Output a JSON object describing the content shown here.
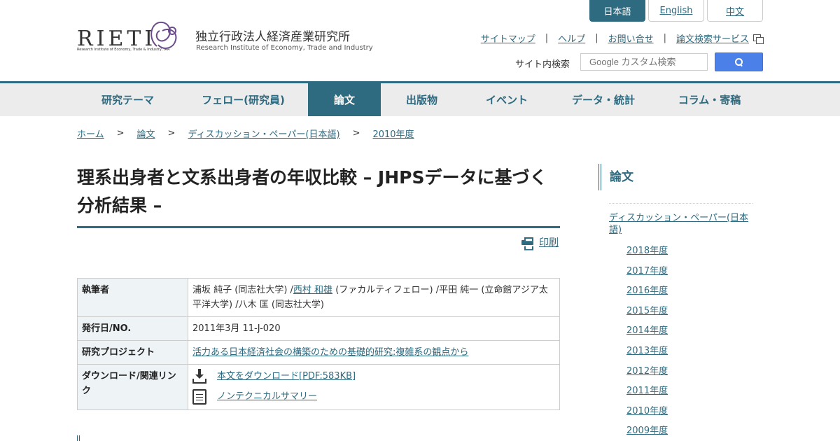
{
  "header": {
    "logo_text": "RIETI",
    "logo_subtext": "Research Institute of Economy, Trade & Industry, IAA",
    "org_name_ja": "独立行政法人経済産業研究所",
    "org_name_en": "Research Institute of Economy, Trade and Industry",
    "languages": [
      {
        "label": "日本語",
        "active": true
      },
      {
        "label": "English",
        "active": false
      },
      {
        "label": "中文",
        "active": false
      }
    ],
    "util_links": [
      "サイトマップ",
      "ヘルプ",
      "お問い合せ",
      "論文検索サービス"
    ],
    "util_separator": "|",
    "search_label": "サイト内検索",
    "search_placeholder": "Google カスタム検索",
    "search_button_icon": "search-icon"
  },
  "nav": {
    "items": [
      {
        "label": "研究テーマ",
        "active": false
      },
      {
        "label": "フェロー(研究員)",
        "active": false
      },
      {
        "label": "論文",
        "active": true
      },
      {
        "label": "出版物",
        "active": false
      },
      {
        "label": "イベント",
        "active": false
      },
      {
        "label": "データ・統計",
        "active": false
      },
      {
        "label": "コラム・寄稿",
        "active": false
      }
    ],
    "accent_color": "#2e6a80"
  },
  "breadcrumb": {
    "items": [
      "ホーム",
      "論文",
      "ディスカッション・ペーパー(日本語)",
      "2010年度"
    ],
    "separator": ">"
  },
  "article": {
    "title": "理系出身者と文系出身者の年収比較 – JHPSデータに基づく分析結果 –",
    "print_label": "印刷",
    "info": {
      "author_label": "執筆者",
      "author_1": "浦坂 純子 (同志社大学) /",
      "author_link": "西村 和雄",
      "author_2": " (ファカルティフェロー) /平田 純一 (立命館アジア太平洋大学) /八木 匡 (同志社大学)",
      "date_label": "発行日/NO.",
      "date_value": "2011年3月 11-J-020",
      "project_label": "研究プロジェクト",
      "project_value": "活力ある日本経済社会の構築のための基礎的研究:複雑系の観点から",
      "download_label": "ダウンロード/関連リンク",
      "download_pdf": "本文をダウンロード[PDF:583KB]",
      "nontech_summary": "ノンテクニカルサマリー"
    }
  },
  "sidebar": {
    "title": "論文",
    "category": "ディスカッション・ペーパー(日本語)",
    "years": [
      "2018年度",
      "2017年度",
      "2016年度",
      "2015年度",
      "2014年度",
      "2013年度",
      "2012年度",
      "2011年度",
      "2010年度",
      "2009年度"
    ]
  }
}
